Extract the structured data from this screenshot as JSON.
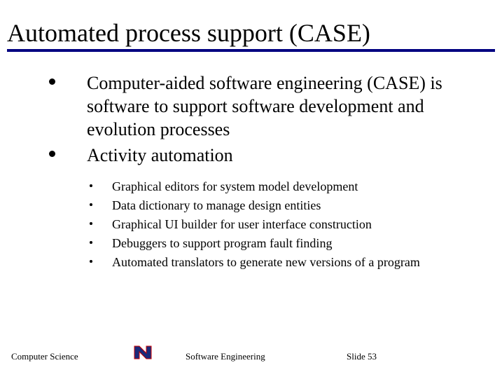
{
  "title": "Automated process support (CASE)",
  "bullets": [
    "Computer-aided software engineering (CASE) is software to support software development and evolution processes",
    "Activity automation"
  ],
  "subbullets": [
    "Graphical editors for system model development",
    "Data dictionary to manage design entities",
    "Graphical UI builder for user interface construction",
    "Debuggers to support program fault finding",
    "Automated translators to generate new versions of a program"
  ],
  "footer": {
    "left": "Computer Science",
    "center": "Software Engineering",
    "right": "Slide  53",
    "logo": "N"
  }
}
